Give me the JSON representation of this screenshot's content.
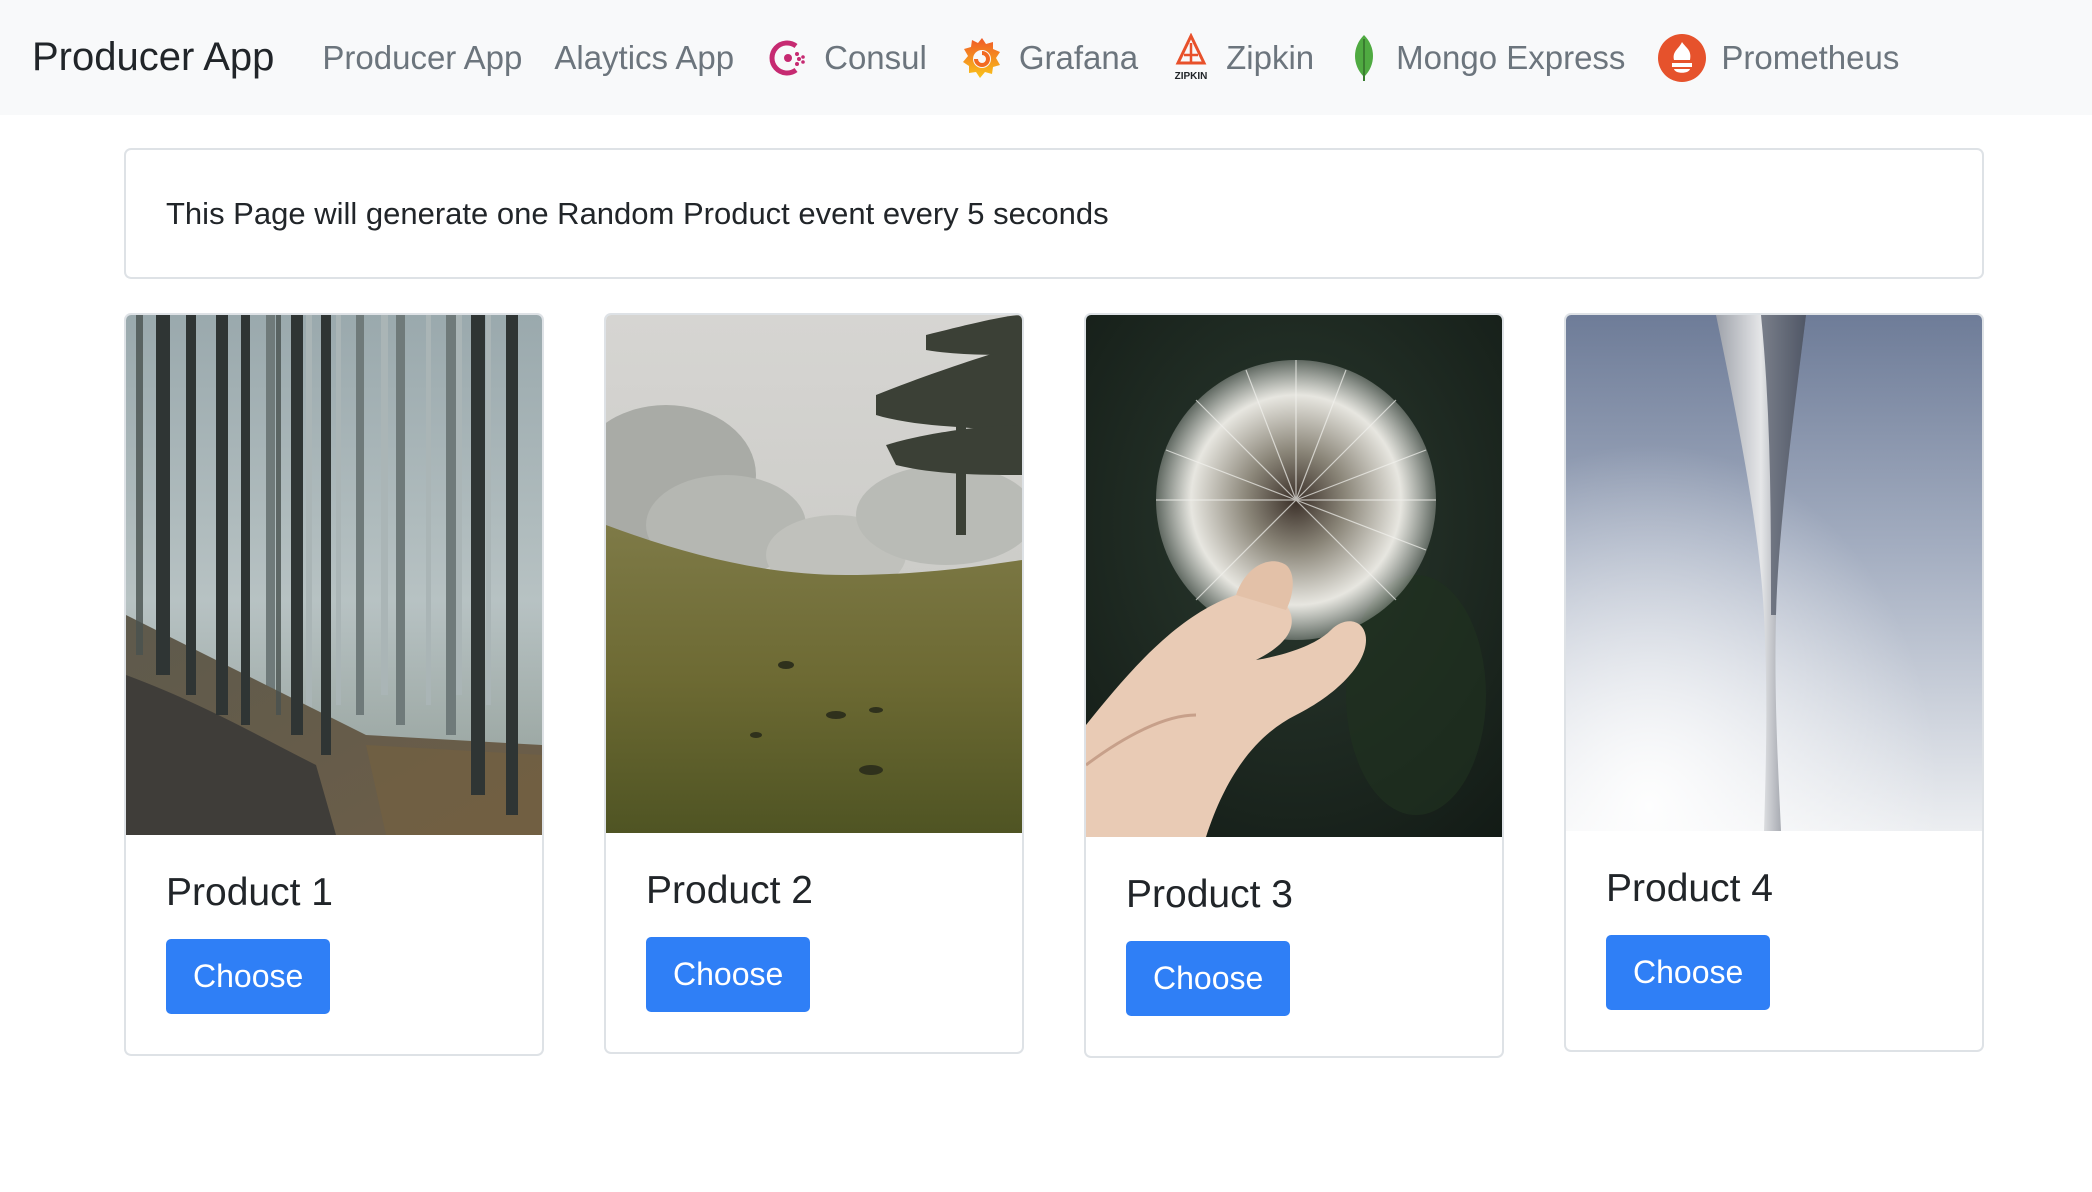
{
  "navbar": {
    "brand": "Producer App",
    "links": [
      {
        "label": "Producer App",
        "icon": null
      },
      {
        "label": "Alaytics App",
        "icon": null
      },
      {
        "label": "Consul",
        "icon": "consul-icon"
      },
      {
        "label": "Grafana",
        "icon": "grafana-icon"
      },
      {
        "label": "Zipkin",
        "icon": "zipkin-icon",
        "icon_text": "ZIPKIN"
      },
      {
        "label": "Mongo Express",
        "icon": "mongo-leaf-icon"
      },
      {
        "label": "Prometheus",
        "icon": "prometheus-icon"
      }
    ]
  },
  "info": {
    "message": "This Page will generate one Random Product event every 5 seconds"
  },
  "products": [
    {
      "title": "Product 1",
      "button_label": "Choose",
      "image": "foggy-forest-path-photo"
    },
    {
      "title": "Product 2",
      "button_label": "Choose",
      "image": "misty-meadow-photo"
    },
    {
      "title": "Product 3",
      "button_label": "Choose",
      "image": "dandelion-in-hand-photo"
    },
    {
      "title": "Product 4",
      "button_label": "Choose",
      "image": "tower-against-sky-photo"
    }
  ],
  "colors": {
    "navbar_bg": "#f8f9fa",
    "button_bg": "#2f7ff6",
    "nav_link": "#6c757d"
  }
}
